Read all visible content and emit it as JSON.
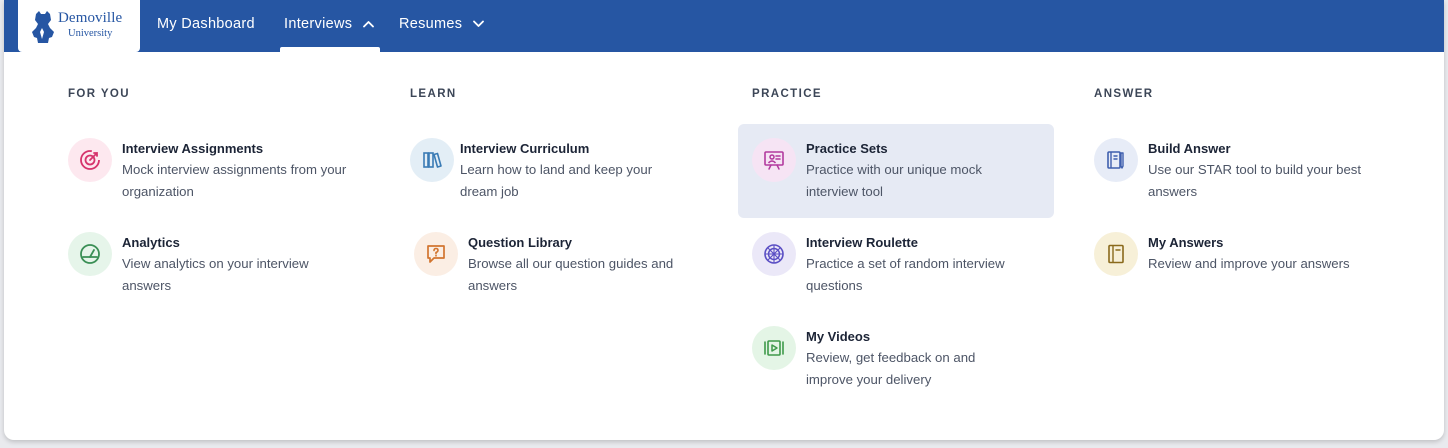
{
  "brand": {
    "name": "Demoville",
    "sub": "University",
    "color": "#2656a3"
  },
  "nav": {
    "dashboard": "My Dashboard",
    "interviews": "Interviews",
    "resumes": "Resumes"
  },
  "columns": {
    "for_you": {
      "heading": "FOR YOU",
      "items": [
        {
          "title": "Interview Assignments",
          "desc": "Mock interview assignments from your organization",
          "icon": "target-icon"
        },
        {
          "title": "Analytics",
          "desc": "View analytics on your interview answers",
          "icon": "gauge-icon"
        }
      ]
    },
    "learn": {
      "heading": "LEARN",
      "items": [
        {
          "title": "Interview Curriculum",
          "desc": "Learn how to land and keep your dream job",
          "icon": "books-icon"
        },
        {
          "title": "Question Library",
          "desc": "Browse all our question guides and answers",
          "icon": "question-bubble-icon"
        }
      ]
    },
    "practice": {
      "heading": "PRACTICE",
      "items": [
        {
          "title": "Practice Sets",
          "desc": "Practice with our unique mock interview tool",
          "icon": "presentation-icon"
        },
        {
          "title": "Interview Roulette",
          "desc": "Practice a set of random interview questions",
          "icon": "roulette-icon"
        },
        {
          "title": "My Videos",
          "desc": "Review, get feedback on and improve your delivery",
          "icon": "video-icon"
        }
      ]
    },
    "answer": {
      "heading": "ANSWER",
      "items": [
        {
          "title": "Build Answer",
          "desc": "Use our STAR tool to build your best answers",
          "icon": "build-icon"
        },
        {
          "title": "My Answers",
          "desc": "Review and improve your answers",
          "icon": "notebook-icon"
        }
      ]
    }
  }
}
